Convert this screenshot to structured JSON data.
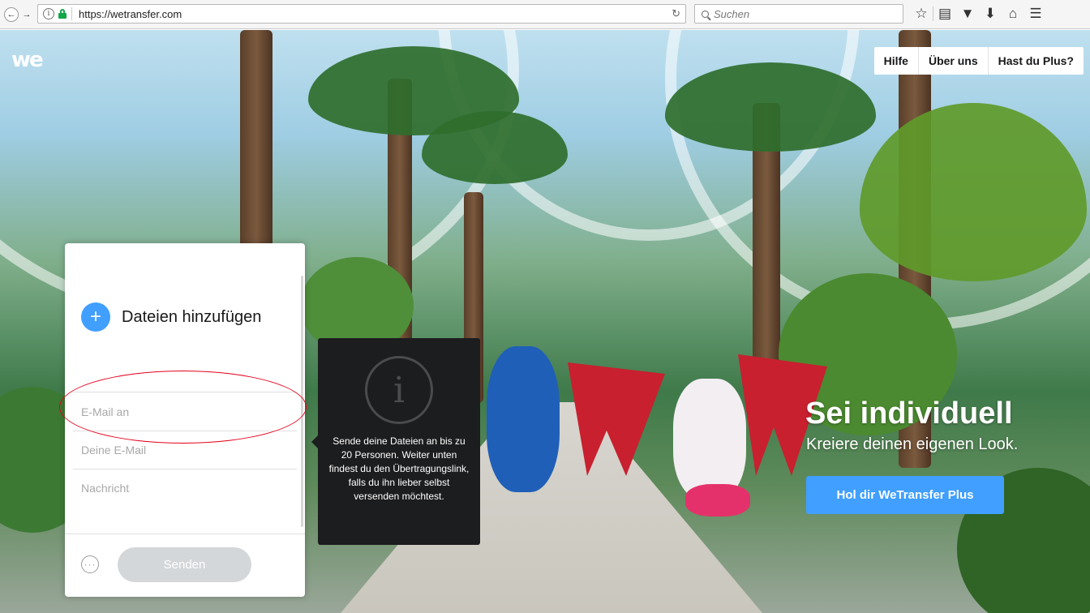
{
  "browser": {
    "url": "https://wetransfer.com",
    "search_placeholder": "Suchen",
    "icons": [
      "back-icon",
      "forward-icon",
      "info-icon",
      "lock-icon",
      "reload-icon",
      "search-icon",
      "bookmark-star-icon",
      "reading-list-icon",
      "pocket-icon",
      "download-icon",
      "home-icon",
      "menu-icon"
    ]
  },
  "header": {
    "logo": "we",
    "nav": [
      "Hilfe",
      "Über uns",
      "Hast du Plus?"
    ]
  },
  "upload_panel": {
    "add_files_label": "Dateien hinzufügen",
    "email_to_placeholder": "E-Mail an",
    "your_email_placeholder": "Deine E-Mail",
    "message_placeholder": "Nachricht",
    "send_label": "Senden"
  },
  "tooltip": {
    "text": "Sende deine Dateien an bis zu 20 Personen. Weiter unten findest du den Übertragungslink, falls du ihn lieber selbst versenden möchtest."
  },
  "promo": {
    "title": "Sei individuell",
    "subtitle": "Kreiere deinen eigenen Look.",
    "button_label": "Hol dir WeTransfer Plus"
  },
  "colors": {
    "accent_blue": "#409fff",
    "highlight_red": "#e3001b",
    "tooltip_bg": "#1c1d1f"
  }
}
